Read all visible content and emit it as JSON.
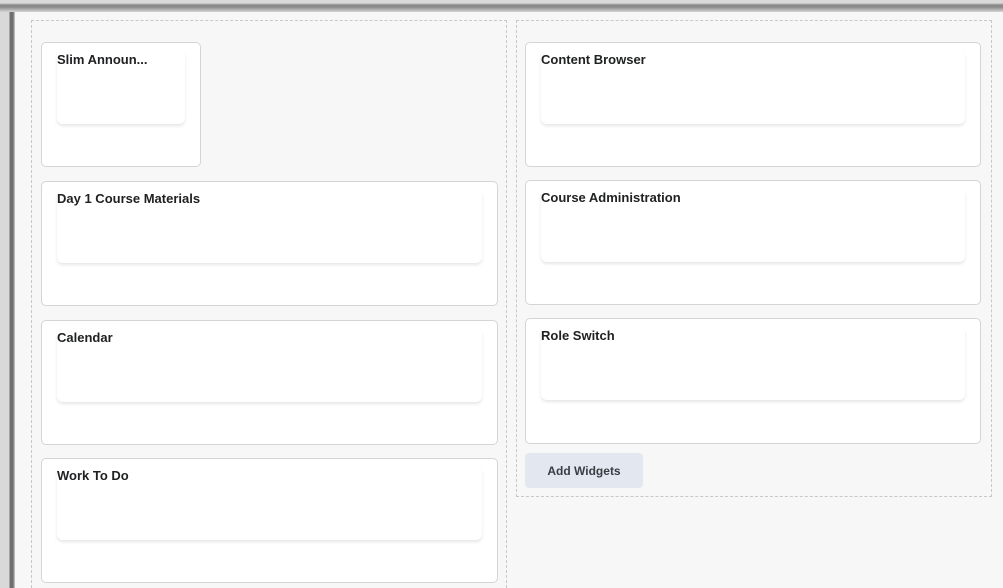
{
  "left_column": {
    "widgets": [
      {
        "title": "Slim Announ..."
      },
      {
        "title": "Day 1 Course Materials"
      },
      {
        "title": "Calendar"
      },
      {
        "title": "Work To Do"
      }
    ]
  },
  "right_column": {
    "widgets": [
      {
        "title": "Content Browser"
      },
      {
        "title": "Course Administration"
      },
      {
        "title": "Role Switch"
      }
    ],
    "add_widgets_label": "Add Widgets"
  }
}
